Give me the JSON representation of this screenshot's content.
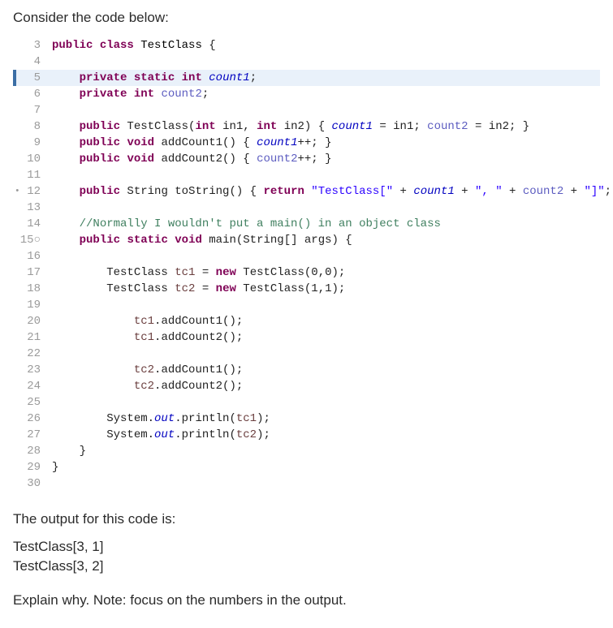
{
  "prompt_top": "Consider the code below:",
  "code": {
    "lines": [
      {
        "n": "3",
        "marker": "",
        "hl": false,
        "html": "<span class='kw'>public</span> <span class='kw'>class</span> <span class='cls'>TestClass</span> {"
      },
      {
        "n": "4",
        "marker": "",
        "hl": false,
        "html": ""
      },
      {
        "n": "5",
        "marker": "",
        "hl": true,
        "html": "    <span class='kw'>private</span> <span class='kw'>static</span> <span class='ty'>int</span> <span class='fld'>count1</span>;"
      },
      {
        "n": "6",
        "marker": "",
        "hl": false,
        "html": "    <span class='kw'>private</span> <span class='ty'>int</span> <span class='fld2'>count2</span>;"
      },
      {
        "n": "7",
        "marker": "",
        "hl": false,
        "html": ""
      },
      {
        "n": "8",
        "marker": "",
        "hl": false,
        "html": "    <span class='kw'>public</span> TestClass(<span class='ty'>int</span> in1, <span class='ty'>int</span> in2) { <span class='fld'>count1</span> = in1; <span class='fld2'>count2</span> = in2; }"
      },
      {
        "n": "9",
        "marker": "",
        "hl": false,
        "html": "    <span class='kw'>public</span> <span class='kw'>void</span> addCount1() { <span class='fld'>count1</span>++; }"
      },
      {
        "n": "10",
        "marker": "",
        "hl": false,
        "html": "    <span class='kw'>public</span> <span class='kw'>void</span> addCount2() { <span class='fld2'>count2</span>++; }"
      },
      {
        "n": "11",
        "marker": "",
        "hl": false,
        "html": ""
      },
      {
        "n": "12",
        "marker": "•",
        "hl": false,
        "html": "    <span class='kw'>public</span> String toString() { <span class='kw-ret'>return</span> <span class='str'>\"TestClass[\"</span> + <span class='fld'>count1</span> + <span class='str'>\", \"</span> + <span class='fld2'>count2</span> + <span class='str'>\"]\"</span>; }"
      },
      {
        "n": "13",
        "marker": "",
        "hl": false,
        "html": ""
      },
      {
        "n": "14",
        "marker": "",
        "hl": false,
        "html": "    <span class='com'>//Normally I wouldn't put a main() in an object class</span>"
      },
      {
        "n": "15○",
        "marker": "",
        "hl": false,
        "html": "    <span class='kw'>public</span> <span class='kw'>static</span> <span class='kw'>void</span> main(String[] args) {"
      },
      {
        "n": "16",
        "marker": "",
        "hl": false,
        "html": ""
      },
      {
        "n": "17",
        "marker": "",
        "hl": false,
        "html": "        TestClass <span class='var'>tc1</span> = <span class='kw'>new</span> TestClass(0,0);"
      },
      {
        "n": "18",
        "marker": "",
        "hl": false,
        "html": "        TestClass <span class='var'>tc2</span> = <span class='kw'>new</span> TestClass(1,1);"
      },
      {
        "n": "19",
        "marker": "",
        "hl": false,
        "html": ""
      },
      {
        "n": "20",
        "marker": "",
        "hl": false,
        "html": "            <span class='var'>tc1</span>.addCount1();"
      },
      {
        "n": "21",
        "marker": "",
        "hl": false,
        "html": "            <span class='var'>tc1</span>.addCount2();"
      },
      {
        "n": "22",
        "marker": "",
        "hl": false,
        "html": ""
      },
      {
        "n": "23",
        "marker": "",
        "hl": false,
        "html": "            <span class='var'>tc2</span>.addCount1();"
      },
      {
        "n": "24",
        "marker": "",
        "hl": false,
        "html": "            <span class='var'>tc2</span>.addCount2();"
      },
      {
        "n": "25",
        "marker": "",
        "hl": false,
        "html": ""
      },
      {
        "n": "26",
        "marker": "",
        "hl": false,
        "html": "        System.<span class='sysi'>out</span>.println(<span class='var'>tc1</span>);"
      },
      {
        "n": "27",
        "marker": "",
        "hl": false,
        "html": "        System.<span class='sysi'>out</span>.println(<span class='var'>tc2</span>);"
      },
      {
        "n": "28",
        "marker": "",
        "hl": false,
        "html": "    }"
      },
      {
        "n": "29",
        "marker": "",
        "hl": false,
        "html": "}"
      },
      {
        "n": "30",
        "marker": "",
        "hl": false,
        "html": ""
      }
    ]
  },
  "after1": "The output for this code is:",
  "out1": "TestClass[3, 1]",
  "out2": "TestClass[3, 2]",
  "explain": "Explain why. Note: focus on the numbers in the output."
}
